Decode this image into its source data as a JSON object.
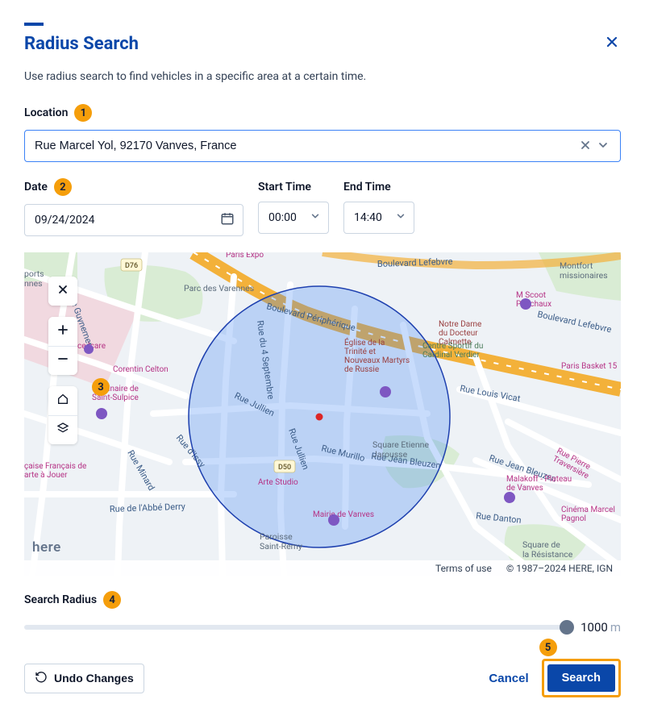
{
  "header": {
    "title": "Radius Search",
    "description": "Use radius search to find vehicles in a specific area at a certain time."
  },
  "callouts": {
    "location": "1",
    "date": "2",
    "map": "3",
    "radius": "4",
    "search": "5"
  },
  "location": {
    "label": "Location",
    "value": "Rue Marcel Yol, 92170 Vanves, France"
  },
  "date": {
    "label": "Date",
    "value": "09/24/2024"
  },
  "startTime": {
    "label": "Start Time",
    "value": "00:00"
  },
  "endTime": {
    "label": "End Time",
    "value": "14:40"
  },
  "map": {
    "terms": "Terms of use",
    "copyright": "© 1987–2024 HERE, IGN",
    "provider": "here",
    "radius_label_circle": "",
    "roads": {
      "periph": "Boulevard Périphérique",
      "lefebvre": "Boulevard Lefebvre",
      "vicat": "Rue Louis Vicat",
      "bleuzen": "Rue Jean Bleuzen",
      "danton": "Rue Danton",
      "sept": "Rue du 4 Septembre",
      "jullien1": "Rue Jullien",
      "jullien2": "Rue Jullien",
      "murillo": "Rue Murillo",
      "issy": "Rue d'Issy",
      "minard": "Rue Minard",
      "guynemer": "Rue Guynemer",
      "abbe": "Rue de l'Abbé Derry"
    },
    "shields": {
      "d76": "D76",
      "d50": "D50"
    },
    "poi": {
      "notre_dame": "Notre Dame du Docteur Calmette",
      "varennes": "Parc des Varennes",
      "expo": "Paris Expo",
      "scoot": "M Scoot Périchaux",
      "basket": "Paris Basket 15",
      "centre_sportif": "Centre Sportif du Cardinal Verdier",
      "celton": "Corentin Celton",
      "sulpice": "Séminaire de Saint-Sulpice",
      "icare": "ce Icare",
      "cartes": "çaise Français de arte à Jouer",
      "arte": "Arte Studio",
      "mairie": "Mairie de Vanves",
      "paroisse": "Paroisse Saint-Rémy",
      "jarousse": "Square Etienne Jarousse",
      "trinite": "Église de la Trinité et Nouveaux Martyrs de Russie",
      "malakoff": "Malakoff - Plateau de Vanves",
      "pagnol": "Cinéma Marcel Pagnol",
      "resistance": "Square de la Résistance",
      "traversiere": "Rue Pierre Traversière",
      "montfort": "Montfort missionaires",
      "ports": "ports nnes"
    }
  },
  "radius": {
    "label": "Search Radius",
    "value": "1000",
    "unit": "m"
  },
  "footer": {
    "undo": "Undo Changes",
    "cancel": "Cancel",
    "search": "Search"
  }
}
